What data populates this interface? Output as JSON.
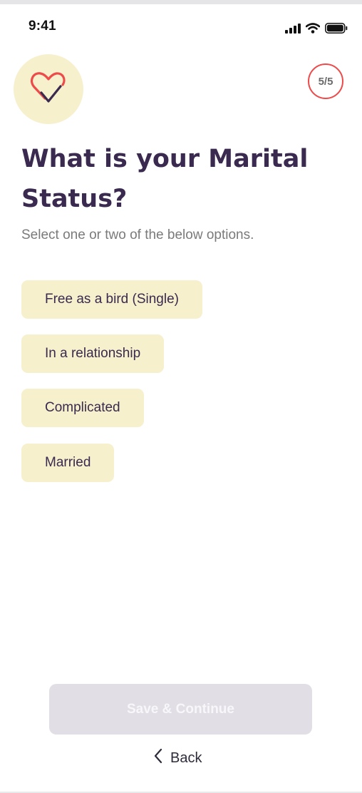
{
  "status_bar": {
    "time": "9:41"
  },
  "header": {
    "step_indicator": "5/5"
  },
  "question": {
    "title": "What is your Marital Status?",
    "subtitle": "Select one or two of the below options."
  },
  "options": [
    {
      "label": "Free as a bird (Single)"
    },
    {
      "label": "In a relationship"
    },
    {
      "label": "Complicated"
    },
    {
      "label": "Married"
    }
  ],
  "footer": {
    "save_label": "Save & Continue",
    "back_label": "Back"
  },
  "colors": {
    "brand_purple": "#3a2a4f",
    "option_bg": "#f6f0cd",
    "accent_red": "#ee4a4a",
    "disabled_button": "#e1dfe5"
  }
}
